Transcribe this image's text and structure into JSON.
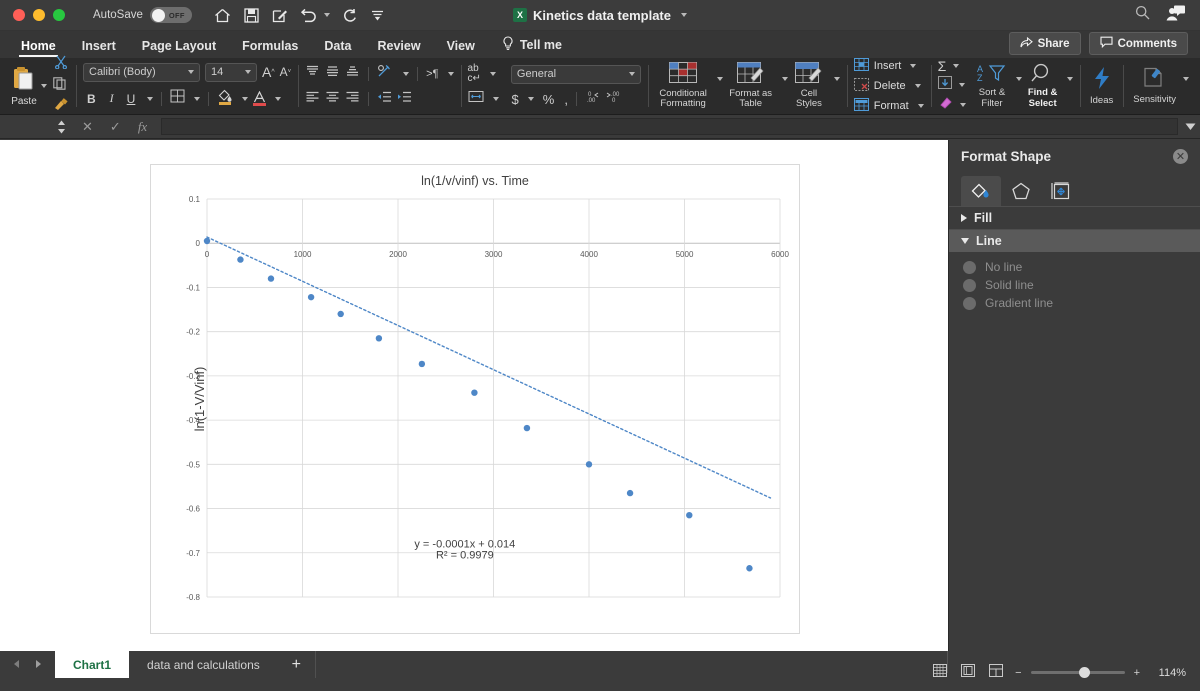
{
  "titlebar": {
    "autosave_label": "AutoSave",
    "autosave_state": "OFF",
    "document_title": "Kinetics data template",
    "quick_access": [
      "home-icon",
      "save-icon",
      "edit-icon",
      "undo-icon",
      "redo-icon",
      "customize-icon"
    ],
    "search_icon": "search-icon",
    "account_icon": "account-icon"
  },
  "ribbon": {
    "tabs": [
      {
        "label": "Home",
        "active": true
      },
      {
        "label": "Insert",
        "active": false
      },
      {
        "label": "Page Layout",
        "active": false
      },
      {
        "label": "Formulas",
        "active": false
      },
      {
        "label": "Data",
        "active": false
      },
      {
        "label": "Review",
        "active": false
      },
      {
        "label": "View",
        "active": false
      }
    ],
    "tell_me": "Tell me",
    "share_label": "Share",
    "comments_label": "Comments",
    "clipboard": {
      "paste_label": "Paste"
    },
    "font": {
      "family": "Calibri (Body)",
      "size": "14",
      "bold": "B",
      "italic": "I",
      "underline": "U"
    },
    "number": {
      "format": "General",
      "currency": "$",
      "percent": "%",
      "comma": ","
    },
    "styles": {
      "conditional_formatting": "Conditional Formatting",
      "format_as_table": "Format as Table",
      "cell_styles": "Cell Styles"
    },
    "cells": {
      "insert": "Insert",
      "delete": "Delete",
      "format": "Format"
    },
    "editing": {
      "sort_filter": "Sort & Filter",
      "find_select": "Find & Select"
    },
    "ideas": "Ideas",
    "sensitivity": "Sensitivity"
  },
  "formula_bar": {
    "name_box_value": "",
    "cancel_icon": "cancel-icon",
    "enter_icon": "confirm-icon",
    "function_icon": "insert-function-icon",
    "formula_value": ""
  },
  "format_shape": {
    "title": "Format Shape",
    "close_icon": "close-icon",
    "tabs": [
      {
        "name": "fill-line-tab",
        "active": true
      },
      {
        "name": "effects-tab",
        "active": false
      },
      {
        "name": "size-properties-tab",
        "active": false
      }
    ],
    "sections": [
      {
        "label": "Fill",
        "expanded": false
      },
      {
        "label": "Line",
        "expanded": true
      }
    ],
    "line_options": [
      {
        "label": "No line",
        "selected": false
      },
      {
        "label": "Solid line",
        "selected": false
      },
      {
        "label": "Gradient line",
        "selected": false
      }
    ]
  },
  "sheet_bar": {
    "tabs": [
      {
        "label": "Chart1",
        "active": true
      },
      {
        "label": "data and calculations",
        "active": false
      }
    ],
    "add_sheet": "+",
    "view_icons": [
      "normal-view-icon",
      "page-layout-icon",
      "page-break-icon"
    ],
    "zoom_out": "−",
    "zoom_in": "+",
    "zoom_level": "114%"
  },
  "chart_data": {
    "type": "scatter",
    "title": "ln(1/v/vinf) vs. Time",
    "xlabel": "",
    "ylabel": "ln(1-V/Vinf)",
    "xlim": [
      0,
      6000
    ],
    "ylim": [
      -0.8,
      0.1
    ],
    "xticks": [
      0,
      1000,
      2000,
      3000,
      4000,
      5000,
      6000
    ],
    "yticks": [
      0.1,
      0,
      -0.1,
      -0.2,
      -0.3,
      -0.4,
      -0.5,
      -0.6,
      -0.7,
      -0.8
    ],
    "grid": true,
    "legend": "none",
    "marker_color": "#4e87c7",
    "trendline": {
      "style": "dotted",
      "color": "#4e87c7",
      "equation": "y = -0.0001x + 0.014",
      "r_squared": "R² = 0.9979",
      "slope": -0.0001,
      "intercept": 0.014
    },
    "x": [
      0,
      350,
      670,
      1090,
      1400,
      1800,
      2250,
      2800,
      3350,
      4000,
      4430,
      5050,
      5680
    ],
    "y": [
      0.005,
      -0.037,
      -0.08,
      -0.122,
      -0.16,
      -0.215,
      -0.273,
      -0.338,
      -0.418,
      -0.5,
      -0.565,
      -0.615,
      -0.735
    ]
  }
}
